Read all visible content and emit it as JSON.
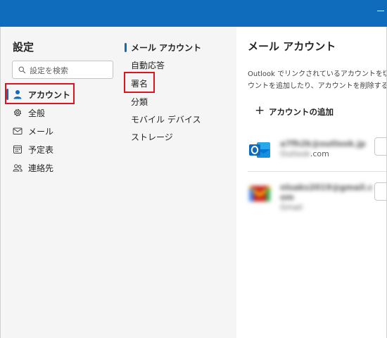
{
  "settings": {
    "title": "設定",
    "search_placeholder": "設定を検索",
    "nav": [
      {
        "label": "アカウント",
        "icon": "person-icon",
        "active": true
      },
      {
        "label": "全般",
        "icon": "gear-icon"
      },
      {
        "label": "メール",
        "icon": "mail-icon"
      },
      {
        "label": "予定表",
        "icon": "calendar-icon"
      },
      {
        "label": "連絡先",
        "icon": "people-icon"
      }
    ]
  },
  "sub_nav": [
    {
      "label": "メール アカウント",
      "active": true
    },
    {
      "label": "自動応答"
    },
    {
      "label": "署名"
    },
    {
      "label": "分類"
    },
    {
      "label": "モバイル デバイス"
    },
    {
      "label": "ストレージ"
    }
  ],
  "content": {
    "title": "メール アカウント",
    "description_lines": [
      "Outlook でリンクされているアカウントを切り替",
      "ウントを追加したり、アカウントを削除することが"
    ],
    "add_account": "アカウントの追加",
    "accounts": [
      {
        "email_blurred": "a7fh2k",
        "email_domain_blurred": "@outlook.jp",
        "email_suffix": ".com",
        "type_blurred": "Outlook",
        "icon": "outlook-icon"
      },
      {
        "email_blurred": "nlsaks2019",
        "email_domain_blurred": "@gmail.c",
        "email_line2_blurred": "om",
        "type_blurred": "Gmail",
        "icon": "gmail-icon"
      }
    ]
  },
  "colors": {
    "accent": "#0f6cbd",
    "highlight_box": "#e0141e",
    "outlook_blue": "#0f6cbd"
  }
}
